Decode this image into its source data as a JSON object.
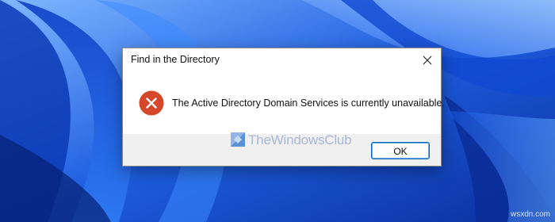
{
  "dialog": {
    "title": "Find in the Directory",
    "message": "The Active Directory Domain Services is currently unavailable.",
    "ok_label": "OK",
    "icon": "error-icon",
    "icon_color": "#d6462b"
  },
  "watermark": {
    "text": "TheWindowsClub",
    "corner_text": "wsxdn.com"
  },
  "colors": {
    "wallpaper_base": "#1f5fd6",
    "dialog_footer": "#f0f0f0",
    "button_border": "#0067c0"
  }
}
